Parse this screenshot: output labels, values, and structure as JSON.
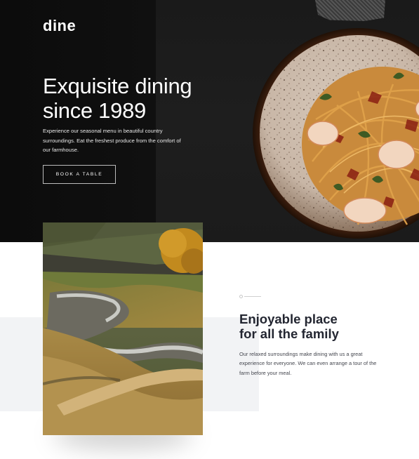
{
  "brand": {
    "logo": "dine"
  },
  "hero": {
    "headline_line1": "Exquisite dining",
    "headline_line2": "since 1989",
    "description": "Experience our seasonal menu in beautiful country surroundings. Eat the freshest produce from the comfort of our farmhouse.",
    "cta_label": "BOOK A TABLE",
    "image_icon": "pasta-dish-photo"
  },
  "family": {
    "title_line1": "Enjoyable place",
    "title_line2": "for all the family",
    "description": "Our relaxed surroundings make dining with us a great experience for everyone. We can even arrange a tour of the farm before your meal.",
    "image_icon": "farm-landscape-photo"
  },
  "colors": {
    "hero_bg": "#111111",
    "title_dark": "#232631",
    "band_gray": "#f2f3f5",
    "accent_gold": "#c28a1e"
  }
}
